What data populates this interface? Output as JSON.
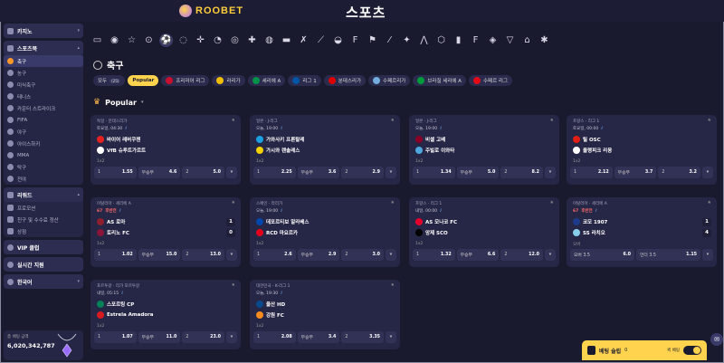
{
  "header": {
    "brand": "ROOBET",
    "title": "스포츠"
  },
  "sidebar": {
    "casino": "카지노",
    "sports": "스포츠북",
    "sport_items": [
      "축구",
      "농구",
      "미식축구",
      "테니스",
      "카운터 스트라이크",
      "FIFA",
      "야구",
      "아이스하키",
      "MMA",
      "탁구",
      "전야"
    ],
    "rewards": "리워드",
    "reward_items": [
      "프로모션",
      "친구 및 수수료 정산",
      "상점"
    ],
    "vip": "VIP 클럽",
    "live_support": "실시간 지원",
    "language": "한국어",
    "jackpot_label": "총 베팅 금액",
    "jackpot_value": "6,020,342,787"
  },
  "sport_icons": [
    "esports-icon",
    "live-icon",
    "star-icon",
    "fifa-icon",
    "soccer-icon",
    "baseball-icon",
    "counter-strike-icon",
    "tennis-icon",
    "basketball-icon",
    "ice-hockey-icon",
    "volleyball-icon",
    "mma-icon",
    "table-tennis-icon",
    "cricket-icon",
    "rugby-icon",
    "fifa-alt-icon",
    "golf-icon",
    "hockey-stick-icon",
    "handball-icon",
    "dota-icon",
    "cycling-icon",
    "league-icon",
    "fifa-alt2-icon",
    "darts-icon",
    "valorant-icon",
    "mobile-legends-icon",
    "mma-alt-icon"
  ],
  "page": {
    "title": "축구",
    "popular": "Popular"
  },
  "chips": [
    {
      "label": "모두",
      "sub": "(25)",
      "selected": false
    },
    {
      "label": "Popular",
      "selected": true
    },
    {
      "label": "프리미어 리그",
      "flag": "#c8102e"
    },
    {
      "label": "라리가",
      "flag": "#f1bf00"
    },
    {
      "label": "세리에 A",
      "flag": "#009246"
    },
    {
      "label": "리그 1",
      "flag": "#0055a4"
    },
    {
      "label": "분데스리가",
      "flag": "#dd0000"
    },
    {
      "label": "수페르리가",
      "flag": "#74acdf"
    },
    {
      "label": "브라질 세리에 A",
      "flag": "#009c3b"
    },
    {
      "label": "수페르 리그",
      "flag": "#e30a17"
    }
  ],
  "matches": [
    {
      "league": "독일 · 분데스리가",
      "time": "토요일, 04:30",
      "live": false,
      "team1": "바이어 레버쿠젠",
      "team2": "VfB 슈투트가르트",
      "c1": "#e32221",
      "c2": "#ffffff",
      "s1": "",
      "s2": "",
      "market": "1x2",
      "odds": [
        [
          "1",
          "1.55"
        ],
        [
          "무승부",
          "4.6"
        ],
        [
          "2",
          "5.0"
        ]
      ]
    },
    {
      "league": "일본 · J-리그",
      "time": "오늘, 19:00",
      "live": false,
      "team1": "가와사키 프론탈레",
      "team2": "가시와 렌솔레스",
      "c1": "#1ba0e2",
      "c2": "#f3d200",
      "s1": "",
      "s2": "",
      "market": "1x2",
      "odds": [
        [
          "1",
          "2.25"
        ],
        [
          "무승부",
          "3.6"
        ],
        [
          "2",
          "2.9"
        ]
      ]
    },
    {
      "league": "일본 · J-리그",
      "time": "오늘, 19:00",
      "live": false,
      "team1": "비셀 고베",
      "team2": "주빌로 이와타",
      "c1": "#8b0026",
      "c2": "#4ea8de",
      "s1": "",
      "s2": "",
      "market": "1x2",
      "odds": [
        [
          "1",
          "1.34"
        ],
        [
          "무승부",
          "5.0"
        ],
        [
          "2",
          "8.2"
        ]
      ]
    },
    {
      "league": "프랑스 · 리그 1",
      "time": "토요일, 00:00",
      "live": false,
      "team1": "릴 OSC",
      "team2": "올랭피크 리옹",
      "c1": "#e01e13",
      "c2": "#ffffff",
      "s1": "",
      "s2": "",
      "market": "1x2",
      "odds": [
        [
          "1",
          "2.12"
        ],
        [
          "무승부",
          "3.7"
        ],
        [
          "2",
          "3.2"
        ]
      ]
    },
    {
      "league": "이탈리아 · 세리에 A",
      "time": "후반전",
      "live": true,
      "stat": "67",
      "team1": "AS 로마",
      "team2": "토리노 FC",
      "c1": "#8e1f2f",
      "c2": "#8a1538",
      "s1": "1",
      "s2": "0",
      "market": "1x2",
      "odds": [
        [
          "1",
          "1.02"
        ],
        [
          "무승부",
          "15.0"
        ],
        [
          "2",
          "13.0"
        ]
      ]
    },
    {
      "league": "스페인 · 라리가",
      "time": "오늘, 19:00",
      "live": false,
      "team1": "데포르티보 알라베스",
      "team2": "RCD 마요르카",
      "c1": "#0047ab",
      "c2": "#e2001a",
      "s1": "",
      "s2": "",
      "market": "1x2",
      "odds": [
        [
          "1",
          "2.6"
        ],
        [
          "무승부",
          "2.9"
        ],
        [
          "2",
          "3.0"
        ]
      ]
    },
    {
      "league": "프랑스 · 리그 1",
      "time": "내일, 00:00",
      "live": false,
      "team1": "AS 모나코 FC",
      "team2": "앙제 SCO",
      "c1": "#e4002b",
      "c2": "#000000",
      "s1": "",
      "s2": "",
      "market": "1x2",
      "odds": [
        [
          "1",
          "1.32"
        ],
        [
          "무승부",
          "6.6"
        ],
        [
          "2",
          "12.0"
        ]
      ]
    },
    {
      "league": "이탈리아 · 세리에 A",
      "time": "후반전",
      "live": true,
      "stat": "67",
      "team1": "코모 1907",
      "team2": "SS 라치오",
      "c1": "#1d3a8a",
      "c2": "#87ceeb",
      "s1": "1",
      "s2": "4",
      "market": "오버",
      "odds": [
        [
          "오버 3.5",
          "6.0"
        ],
        [
          "언더 3.5",
          "1.15"
        ]
      ]
    },
    {
      "league": "포르투갈 · 리가 포르투갈",
      "time": "내일, 05:15",
      "live": false,
      "team1": "스포르팅 CP",
      "team2": "Estrela Amadora",
      "c1": "#008057",
      "c2": "#d71920",
      "s1": "",
      "s2": "",
      "market": "1x2",
      "odds": [
        [
          "1",
          "1.07"
        ],
        [
          "무승부",
          "11.0"
        ],
        [
          "2",
          "23.0"
        ]
      ]
    },
    {
      "league": "대한민국 · K-리그 1",
      "time": "오늘, 19:30",
      "live": false,
      "team1": "울산 HD",
      "team2": "강원 FC",
      "c1": "#0a4a8c",
      "c2": "#f68b1f",
      "s1": "",
      "s2": "",
      "market": "1x2",
      "odds": [
        [
          "1",
          "2.08"
        ],
        [
          "무승부",
          "3.4"
        ],
        [
          "2",
          "3.35"
        ]
      ]
    }
  ],
  "betslip": {
    "label": "베팅 슬립",
    "count": "0",
    "quick": "퀵 베팅"
  }
}
